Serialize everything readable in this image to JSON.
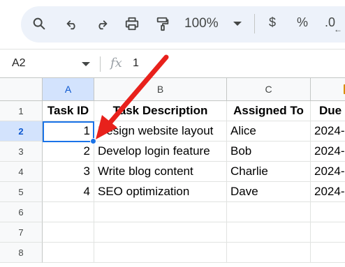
{
  "toolbar": {
    "zoom": "100%",
    "currency_symbol": "$",
    "percent_symbol": "%",
    "decimal_label": ".0"
  },
  "formula_bar": {
    "name_box": "A2",
    "fx_symbol": "fx",
    "formula_value": "1"
  },
  "sheet": {
    "columns": [
      "A",
      "B",
      "C",
      "D"
    ],
    "rows": [
      "1",
      "2",
      "3",
      "4",
      "5",
      "6",
      "7",
      "8"
    ],
    "cells": [
      [
        "Task ID",
        "Task Description",
        "Assigned To",
        "Due"
      ],
      [
        "1",
        "Design website layout",
        "Alice",
        "2024-"
      ],
      [
        "2",
        "Develop login feature",
        "Bob",
        "2024-"
      ],
      [
        "3",
        "Write blog content",
        "Charlie",
        "2024-"
      ],
      [
        "4",
        "SEO optimization",
        "Dave",
        "2024-"
      ]
    ],
    "active_cell": "A2"
  },
  "colors": {
    "selection": "#1a73e8",
    "annotation_arrow": "#e8211c",
    "active_header_bg": "#d3e3fd"
  }
}
